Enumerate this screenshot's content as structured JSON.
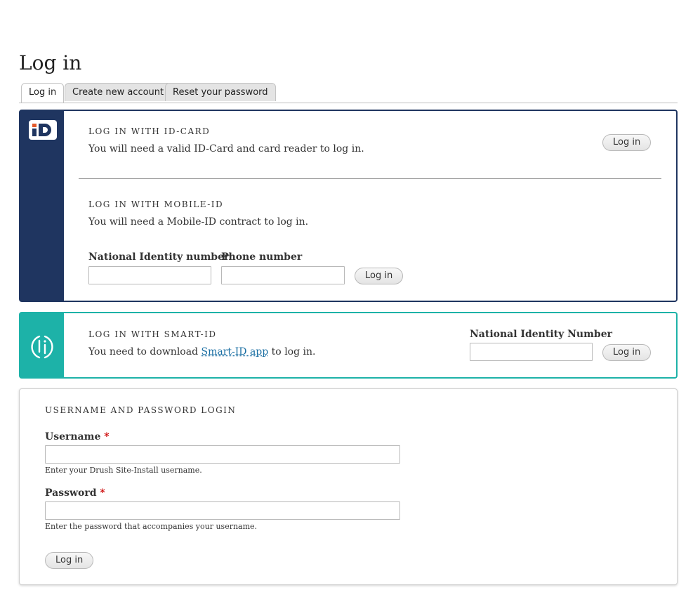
{
  "page": {
    "title": "Log in"
  },
  "tabs": [
    {
      "label": "Log in",
      "active": true
    },
    {
      "label": "Create new account",
      "active": false
    },
    {
      "label": "Reset your password",
      "active": false
    }
  ],
  "id_card": {
    "title": "LOG IN WITH ID-CARD",
    "description": "You will need a valid ID-Card and card reader to log in.",
    "button": "Log in",
    "logo_text": "iD"
  },
  "mobile_id": {
    "title": "LOG IN WITH MOBILE-ID",
    "description": "You will need a Mobile-ID contract to log in.",
    "national_id_label": "National Identity number",
    "national_id_value": "",
    "phone_label": "Phone number",
    "phone_value": "",
    "button": "Log in"
  },
  "smart_id": {
    "title": "LOG IN WITH SMART-ID",
    "description_before": "You need to download ",
    "link_text": "Smart-ID app",
    "description_after": " to log in.",
    "national_id_label": "National Identity Number",
    "national_id_value": "",
    "button": "Log in"
  },
  "user_login": {
    "title": "USERNAME AND PASSWORD LOGIN",
    "username_label": "Username",
    "username_value": "",
    "username_hint": "Enter your Drush Site-Install username.",
    "password_label": "Password",
    "password_value": "",
    "password_hint": "Enter the password that accompanies your username.",
    "required_marker": "*",
    "button": "Log in"
  },
  "colors": {
    "id_card_brand": "#1f3560",
    "smart_id_brand": "#1db2a8",
    "id_logo_accent": "#e2592a",
    "link": "#1b6fa3",
    "required": "#cc0000"
  }
}
